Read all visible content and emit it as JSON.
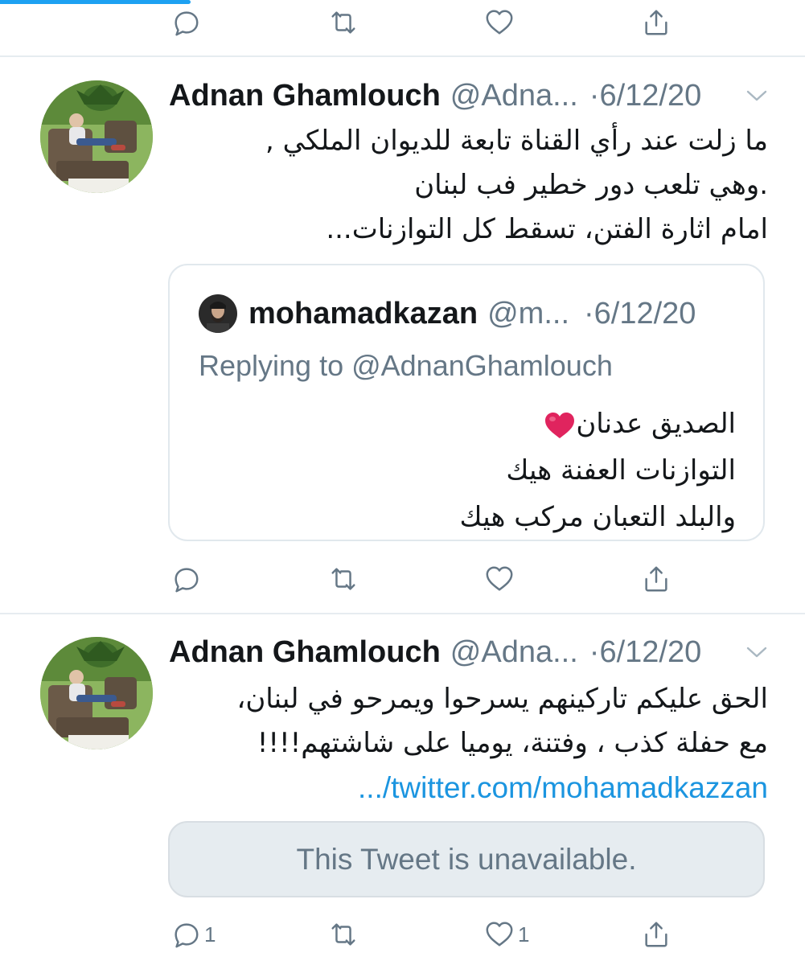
{
  "colors": {
    "accent": "#1da1f2",
    "link": "#1b95e0",
    "secondary_text": "#657786",
    "divider": "#e6ecf0",
    "heart_emoji": "#e0245e"
  },
  "top_actions": {
    "reply_icon": "reply-icon",
    "retweet_icon": "retweet-icon",
    "like_icon": "heart-icon",
    "share_icon": "share-icon"
  },
  "tweets": [
    {
      "author_name": "Adnan Ghamlouch",
      "handle": "@Adna...",
      "separator": "·",
      "date": "6/12/20",
      "lines": [
        "ما زلت عند رأي القناة تابعة للديوان الملكي ,",
        ".وهي تلعب دور خطير فب لبنان",
        "امام اثارة الفتن، تسقط كل التوازنات..."
      ],
      "quote": {
        "author_name": "mohamadkazan",
        "handle": "@m...",
        "separator": "·",
        "date": "6/12/20",
        "replying_to": "Replying to @AdnanGhamlouch",
        "lines": [
          "الصديق عدنان",
          "التوازنات العفنة هيك",
          "والبلد التعبان مركب هيك"
        ],
        "emoji": "red-heart-emoji"
      },
      "actions": {
        "reply_count": "",
        "retweet_count": "",
        "like_count": ""
      }
    },
    {
      "author_name": "Adnan Ghamlouch",
      "handle": "@Adna...",
      "separator": "·",
      "date": "6/12/20",
      "lines": [
        "الحق عليكم تاركينهم يسرحوا ويمرحو في لبنان،",
        "مع حفلة كذب ، وفتنة، يوميا على شاشتهم!!!!"
      ],
      "link": ".../twitter.com/mohamadkazzan",
      "unavailable": "This Tweet is unavailable.",
      "actions": {
        "reply_count": "1",
        "retweet_count": "",
        "like_count": "1"
      }
    }
  ]
}
